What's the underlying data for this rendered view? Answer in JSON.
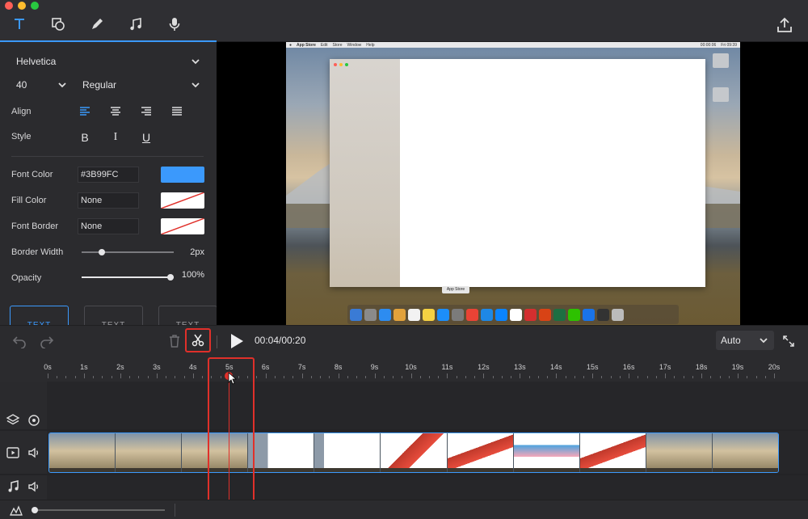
{
  "toolbar_top": {
    "tabs": [
      {
        "name": "text",
        "icon": "text-icon",
        "active": true
      },
      {
        "name": "shapes",
        "icon": "shapes-icon"
      },
      {
        "name": "draw",
        "icon": "pencil-icon"
      },
      {
        "name": "music",
        "icon": "music-note-icon"
      },
      {
        "name": "voiceover",
        "icon": "microphone-icon"
      }
    ],
    "export_icon": "export-icon"
  },
  "text_panel": {
    "font_family": "Helvetica",
    "font_size": "40",
    "font_weight": "Regular",
    "align_label": "Align",
    "style_label": "Style",
    "style_bold": "B",
    "style_italic": "I",
    "style_underline": "U",
    "font_color_label": "Font Color",
    "font_color_value": "#3B99FC",
    "font_color_swatch": "#3b99fc",
    "fill_color_label": "Fill Color",
    "fill_color_value": "None",
    "font_border_label": "Font Border",
    "font_border_value": "None",
    "border_width_label": "Border Width",
    "border_width_value": "2px",
    "border_width_level": 0.22,
    "opacity_label": "Opacity",
    "opacity_value": "100%",
    "opacity_level": 1.0,
    "presets": [
      "TEXT",
      "TEXT",
      "TEXT"
    ]
  },
  "preview": {
    "menubar_left": [
      "App Store",
      "Edit",
      "Store",
      "Window",
      "Help"
    ],
    "menubar_right": "00:00:06",
    "menubar_clock": "Fri 09:39",
    "tooltip": "App Store"
  },
  "editor_toolbar": {
    "time": "00:04/00:20",
    "zoom": "Auto"
  },
  "timeline": {
    "ticks": [
      "0s",
      "1s",
      "2s",
      "3s",
      "4s",
      "5s",
      "6s",
      "7s",
      "8s",
      "9s",
      "10s",
      "11s",
      "12s",
      "13s",
      "14s",
      "15s",
      "16s",
      "17s",
      "18s",
      "19s",
      "20s"
    ],
    "duration_seconds": 20,
    "playhead_seconds": 5
  },
  "colors": {
    "accent": "#3b99fc",
    "highlight": "#e0302a"
  }
}
